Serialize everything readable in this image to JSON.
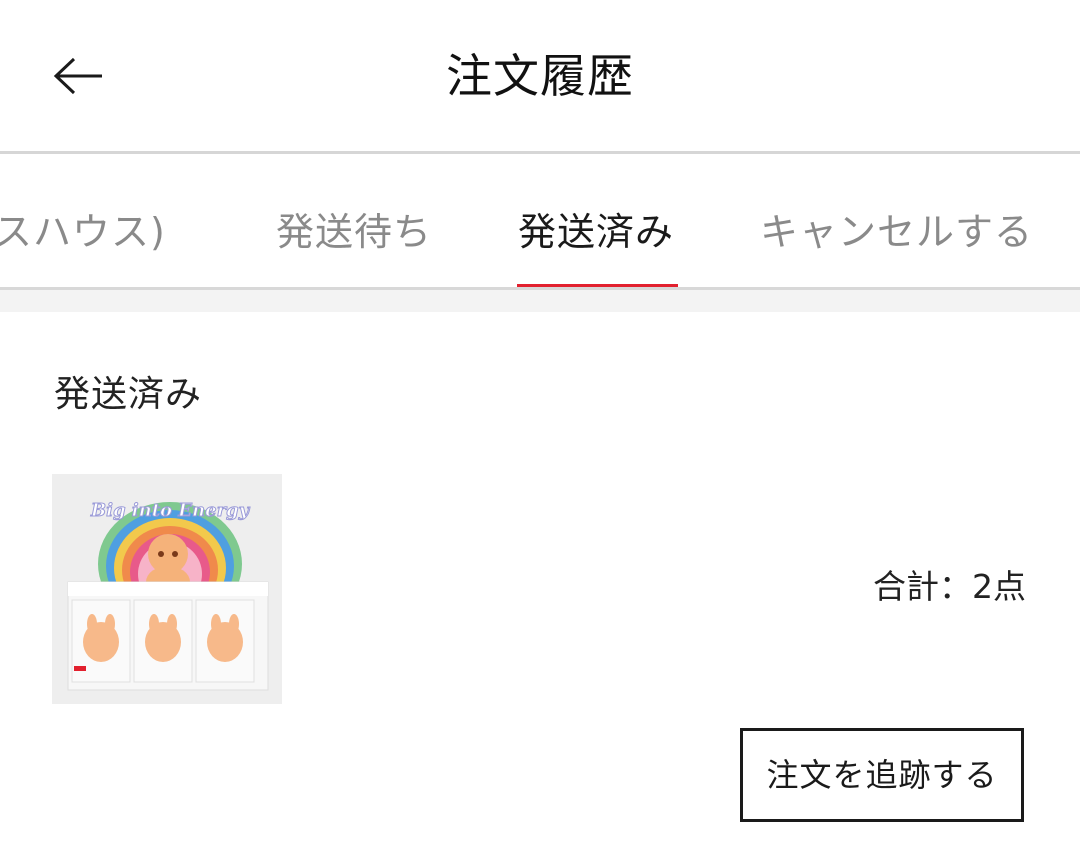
{
  "header": {
    "title": "注文履歴",
    "back_icon": "arrow-left-icon"
  },
  "tabs": [
    {
      "label": "スハウス)",
      "active": false
    },
    {
      "label": "発送待ち",
      "active": false
    },
    {
      "label": "発送済み",
      "active": true
    },
    {
      "label": "キャンセルする",
      "active": false
    }
  ],
  "order": {
    "status": "発送済み",
    "product_image_text": "Big into Energy",
    "total": "合計：2点",
    "track_button": "注文を追跡する"
  },
  "colors": {
    "accent": "#e2202e",
    "active_tab_text": "#1a1a1a",
    "inactive_tab_text": "#8a8a8a"
  }
}
